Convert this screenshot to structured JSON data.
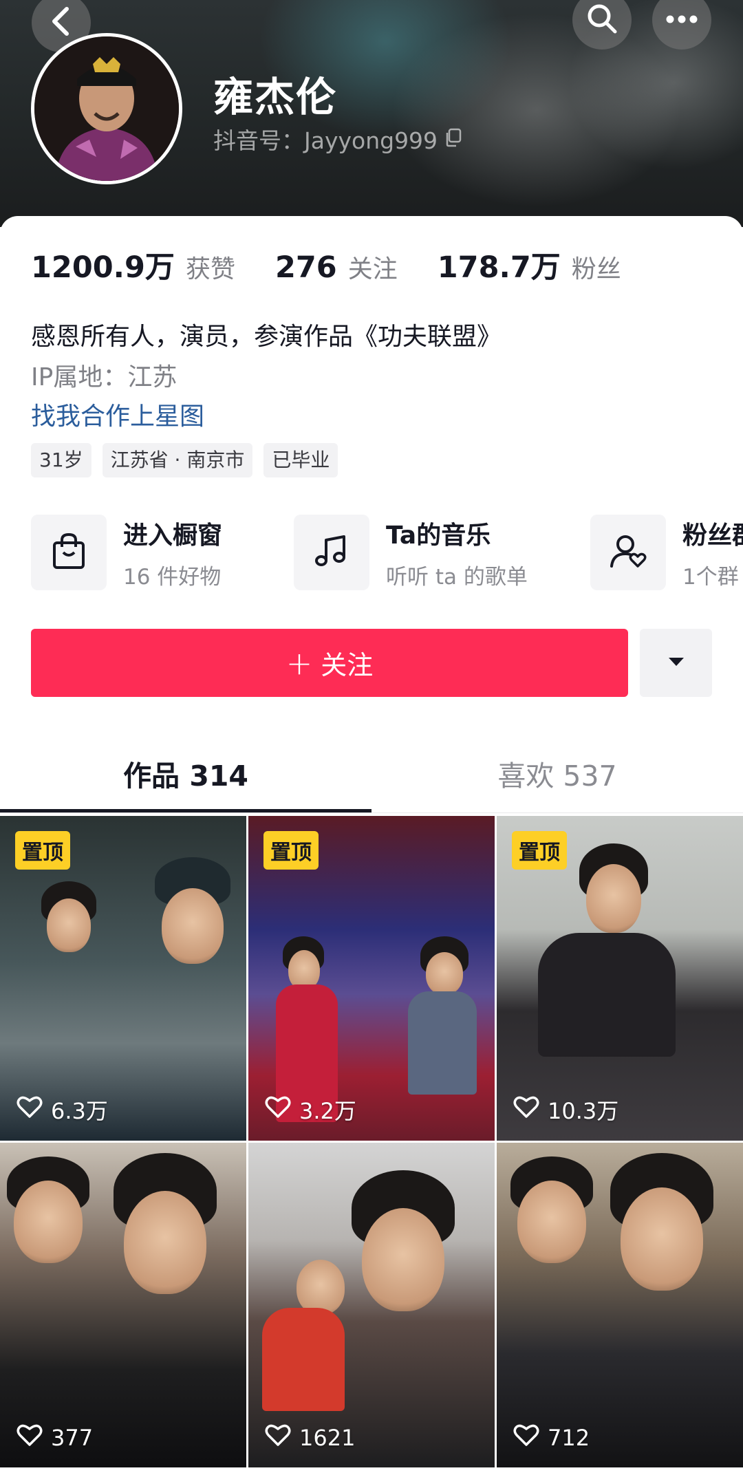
{
  "profile": {
    "nickname": "雍杰伦",
    "account_label": "抖音号：Jayyong999"
  },
  "stats": [
    {
      "value": "1200.9万",
      "label": "获赞"
    },
    {
      "value": "276",
      "label": "关注"
    },
    {
      "value": "178.7万",
      "label": "粉丝"
    }
  ],
  "bio": {
    "text": "感恩所有人，演员，参演作品《功夫联盟》",
    "ip_location": "IP属地：江苏",
    "link": "找我合作上星图"
  },
  "tags": [
    "31岁",
    "江苏省 · 南京市",
    "已毕业"
  ],
  "shortcuts": [
    {
      "title": "进入橱窗",
      "subtitle": "16 件好物",
      "icon": "shopping-bag-icon"
    },
    {
      "title": "Ta的音乐",
      "subtitle": "听听 ta 的歌单",
      "icon": "music-note-icon"
    },
    {
      "title": "粉丝群",
      "subtitle": "1个群",
      "icon": "fan-group-icon"
    }
  ],
  "actions": {
    "follow_label": "关注",
    "follow_plus": "+"
  },
  "tabs": [
    {
      "label": "作品 314",
      "active": true
    },
    {
      "label": "喜欢 537",
      "active": false
    }
  ],
  "videos": [
    {
      "pinned": true,
      "pin_label": "置顶",
      "likes": "6.3万"
    },
    {
      "pinned": true,
      "pin_label": "置顶",
      "likes": "3.2万"
    },
    {
      "pinned": true,
      "pin_label": "置顶",
      "likes": "10.3万"
    },
    {
      "pinned": false,
      "likes": "377"
    },
    {
      "pinned": false,
      "likes": "1621"
    },
    {
      "pinned": false,
      "likes": "712"
    }
  ],
  "colors": {
    "accent": "#fe2c55",
    "link": "#2b5d9c",
    "pin_badge": "#fdcf26"
  }
}
